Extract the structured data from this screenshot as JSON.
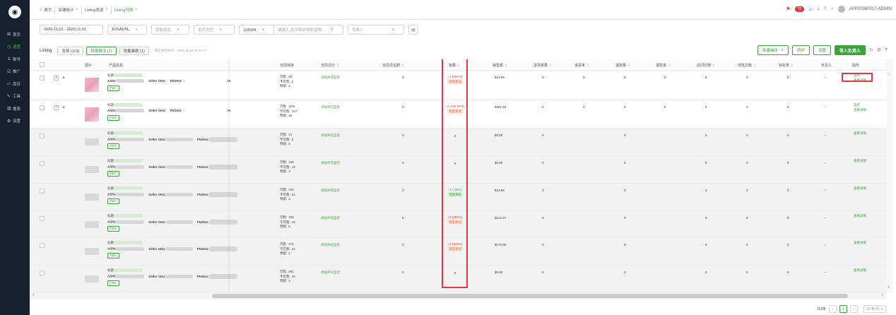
{
  "sidebar": {
    "items": [
      {
        "icon": "grid-icon",
        "glyph": "⊞",
        "label": "首页"
      },
      {
        "icon": "clock-icon",
        "glyph": "◷",
        "label": "运营",
        "active": true
      },
      {
        "icon": "user-icon",
        "glyph": "♙",
        "label": "账号"
      },
      {
        "icon": "promo-icon",
        "glyph": "☑",
        "label": "推广"
      },
      {
        "icon": "warehouse-icon",
        "glyph": "▱",
        "label": "库存"
      },
      {
        "icon": "tools-icon",
        "glyph": "✎",
        "label": "工具"
      },
      {
        "icon": "report-icon",
        "glyph": "▥",
        "label": "报表"
      },
      {
        "icon": "settings-icon",
        "glyph": "⚙",
        "label": "设置"
      }
    ]
  },
  "tabs": [
    {
      "label": "首页",
      "icon": "home-icon",
      "glyph": "⌂",
      "closable": false
    },
    {
      "label": "店铺统计",
      "closable": true
    },
    {
      "label": "Listing表现",
      "closable": true
    },
    {
      "label": "Listing列表",
      "closable": true,
      "active": true
    }
  ],
  "topbar": {
    "badge": "76",
    "user": "APP20060017-ADMIN"
  },
  "filters": {
    "date_range": "2020-11-01 - 2020-11-01",
    "shop": "1USADSL",
    "status_placeholder": "销售状态",
    "ship_type_placeholder": "发货类型",
    "sku_type_placeholder": "",
    "asin_type": "父ASIN",
    "search_placeholder": "请输入,支持精准搜索逗隔...",
    "owner_placeholder": "负责人"
  },
  "listing_bar": {
    "title": "Listing",
    "tabs": [
      {
        "label": "全部 (113)"
      },
      {
        "label": "销量暴涨 (2)",
        "active": true
      },
      {
        "label": "销量暴跌 (1)"
      }
    ],
    "updated": "最近更新时间：2020-11-16 00:20:47",
    "actions": {
      "batch": "批量操作",
      "sync": "同步",
      "settings": "设置",
      "import": "导入负责人"
    }
  },
  "table": {
    "headers": [
      "图片",
      "产品信息",
      "当前库存",
      "当前评分",
      "当前评论数",
      "销量",
      "销售额",
      "退货数量",
      "退货率",
      "退款量",
      "退款率",
      "访问次数",
      "浏览次数",
      "转化率",
      "负责人",
      "操作"
    ],
    "labels": {
      "title": "标题:",
      "asin": "ASIN:",
      "seller_sku": "Seller SKU:",
      "fnsku": "FNSKU:",
      "fba": "FBA",
      "available": "可售:",
      "unavailable": "不可售:",
      "reserved": "预留:",
      "monitor": "添加评论监控",
      "detail": "查看详情",
      "history": "监控"
    },
    "rows": [
      {
        "expand": true,
        "fnsku": "-",
        "price_frag": ".99",
        "available": "19",
        "unavailable": "2",
        "reserved": "1",
        "reviews": "0",
        "sales_main": "↑1 (200%)",
        "sales_tag": "销量暴涨",
        "sales_color": "red",
        "revenue": "$13.99",
        "ret_qty": "0",
        "ret_rate": "0",
        "refund": "0",
        "refund_rate": "0",
        "visits": "0",
        "views": "0",
        "conv": "0",
        "owner": "--",
        "ops": [
          "监控",
          "查看详情"
        ]
      },
      {
        "expand": true,
        "fnsku": "-",
        "price_frag": ".99",
        "available": "1116",
        "unavailable": "107",
        "reserved": "26",
        "reviews": "0",
        "sales_main": "↑4 (166.67%)",
        "sales_tag": "销量暴涨",
        "sales_color": "red",
        "revenue": "$351.92",
        "ret_qty": "0",
        "ret_rate": "0",
        "refund": "0",
        "refund_rate": "0",
        "visits": "0",
        "views": "0",
        "conv": "0",
        "owner": "--",
        "ops": [
          "监控",
          "查看详情"
        ]
      },
      {
        "expand": false,
        "fnsku": "",
        "price_frag": "",
        "available": "21",
        "unavailable": "0",
        "reserved": "6",
        "reviews": "0",
        "sales_main": "0",
        "sales_tag": "",
        "sales_color": "",
        "revenue": "$0.00",
        "ret_qty": "0",
        "ret_rate": "",
        "refund": "0",
        "refund_rate": "",
        "visits": "0",
        "views": "0",
        "conv": "0",
        "owner": "--",
        "ops": [
          "查看详情"
        ]
      },
      {
        "expand": false,
        "fnsku": "",
        "price_frag": "",
        "available": "169",
        "unavailable": "10",
        "reserved": "3",
        "reviews": "0",
        "sales_main": "0",
        "sales_tag": "",
        "sales_color": "",
        "revenue": "$0.00",
        "ret_qty": "0",
        "ret_rate": "",
        "refund": "0",
        "refund_rate": "",
        "visits": "0",
        "views": "0",
        "conv": "0",
        "owner": "--",
        "ops": [
          "查看详情"
        ]
      },
      {
        "expand": false,
        "fnsku": "",
        "price_frag": "",
        "available": "210",
        "unavailable": "24",
        "reserved": "3",
        "reviews": "0",
        "sales_main": "↓1 (-50%)",
        "sales_tag": "销量暴跌",
        "sales_color": "green",
        "revenue": "$43.89",
        "ret_qty": "0",
        "ret_rate": "",
        "refund": "0",
        "refund_rate": "",
        "visits": "0",
        "views": "0",
        "conv": "0",
        "owner": "--",
        "ops": [
          "查看详情"
        ]
      },
      {
        "expand": false,
        "fnsku": "",
        "price_frag": "",
        "available": "169",
        "unavailable": "22",
        "reserved": "5",
        "reviews": "0",
        "sales_main": "↑2 (200%)",
        "sales_tag": "销量暴涨",
        "sales_color": "red",
        "revenue": "$121.97",
        "ret_qty": "0",
        "ret_rate": "",
        "refund": "0",
        "refund_rate": "",
        "visits": "0",
        "views": "0",
        "conv": "0",
        "owner": "--",
        "ops": [
          "查看详情"
        ]
      },
      {
        "expand": false,
        "fnsku": "",
        "price_frag": "",
        "available": "176",
        "unavailable": "22",
        "reserved": "4",
        "reviews": "0",
        "sales_main": "↑4 (400%)",
        "sales_tag": "销量暴涨",
        "sales_color": "red",
        "revenue": "$175.96",
        "ret_qty": "0",
        "ret_rate": "",
        "refund": "0",
        "refund_rate": "",
        "visits": "0",
        "views": "0",
        "conv": "0",
        "owner": "--",
        "ops": [
          "查看详情"
        ]
      },
      {
        "expand": false,
        "fnsku": "",
        "price_frag": "",
        "available": "361",
        "unavailable": "19",
        "reserved": "3",
        "reviews": "0",
        "sales_main": "0",
        "sales_tag": "",
        "sales_color": "",
        "revenue": "$0.00",
        "ret_qty": "0",
        "ret_rate": "",
        "refund": "0",
        "refund_rate": "",
        "visits": "0",
        "views": "0",
        "conv": "0",
        "owner": "--",
        "ops": [
          "查看详情"
        ]
      }
    ]
  },
  "pager": {
    "total": "共2条",
    "current": "1",
    "page_size": "20 条/页"
  }
}
